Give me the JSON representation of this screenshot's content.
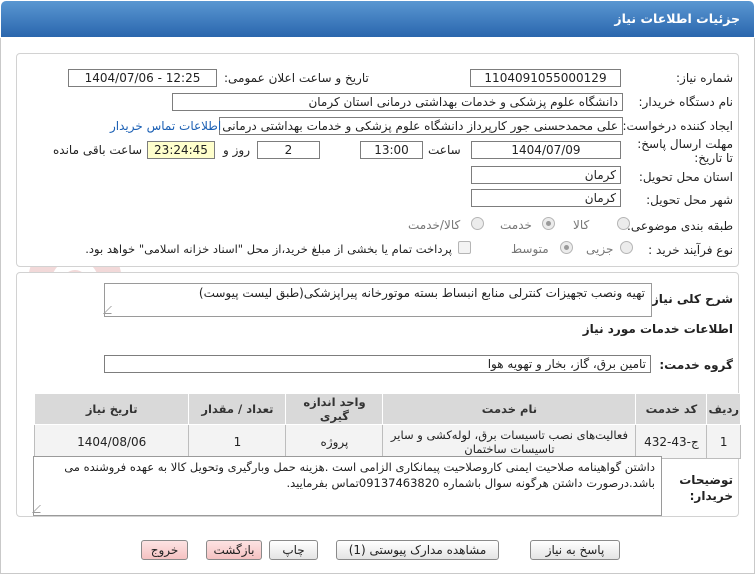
{
  "header": {
    "title": "جزئیات اطلاعات نیاز"
  },
  "form": {
    "need_number_label": "شماره نیاز:",
    "need_number": "1104091055000129",
    "announce_label": "تاریخ و ساعت اعلان عمومی:",
    "announce_value": "1404/07/06 - 12:25",
    "buyer_label": "نام دستگاه خریدار:",
    "buyer_value": "دانشگاه علوم پزشکی و خدمات بهداشتی درمانی استان کرمان",
    "creator_label": "ایجاد کننده درخواست:",
    "creator_value": "علی محمدحسنی جور کارپرداز دانشگاه علوم پزشکی و خدمات بهداشتی درمانی",
    "contact_link": "اطلاعات تماس خریدار",
    "deadline_label": "مهلت ارسال پاسخ: تا تاریخ:",
    "deadline_date": "1404/07/09",
    "time_label": "ساعت",
    "deadline_time": "13:00",
    "days_value": "2",
    "days_label": "روز و",
    "remaining_time": "23:24:45",
    "remaining_label": "ساعت باقی مانده",
    "province_label": "استان محل تحویل:",
    "province_value": "کرمان",
    "city_label": "شهر محل تحویل:",
    "city_value": "کرمان",
    "category_label": "طبقه بندی موضوعی:",
    "category_options": [
      "کالا",
      "خدمت",
      "کالا/خدمت"
    ],
    "category_selected": "خدمت",
    "process_label": "نوع فرآیند خرید :",
    "process_options": [
      "جزیی",
      "متوسط"
    ],
    "process_selected": "متوسط",
    "payment_note": "پرداخت تمام یا بخشی از مبلغ خرید،از محل \"اسناد خزانه اسلامی\" خواهد بود."
  },
  "details": {
    "summary_label": "شرح کلی نیاز:",
    "summary_value": "تهیه ونصب تجهیزات کنترلی منابع انبساط بسته موتورخانه پیراپزشکی(طبق لیست پیوست)",
    "services_heading": "اطلاعات خدمات مورد نیاز",
    "service_group_label": "گروه خدمت:",
    "service_group_value": "تامین برق، گاز، بخار و تهویه هوا",
    "table": {
      "columns": [
        "ردیف",
        "کد خدمت",
        "نام خدمت",
        "واحد اندازه گیری",
        "تعداد / مقدار",
        "تاریخ نیاز"
      ],
      "rows": [
        {
          "row": "1",
          "code": "ج-43-432",
          "name": "فعالیت‌های نصب تاسیسات برق، لوله‌کشی و سایر تاسیسات ساختمان",
          "unit": "پروژه",
          "qty": "1",
          "date": "1404/08/06"
        }
      ]
    },
    "buyer_notes_label": "توضیحات خریدار:",
    "buyer_notes": "داشتن گواهینامه صلاحیت ایمنی کاروصلاحیت پیمانکاری الزامی است .هزینه حمل وبارگیری وتحویل کالا به عهده فروشنده می باشد.درصورت داشتن هرگونه سوال باشماره 09137463820تماس بفرمایید."
  },
  "buttons": {
    "reply": "پاسخ به نیاز",
    "attachments": "مشاهده مدارک پیوستی (1)",
    "print": "چاپ",
    "back": "بازگشت",
    "exit": "خروج"
  },
  "watermark": {
    "text": "AriaTender.net"
  },
  "colors": {
    "header_top": "#5a97d2",
    "header_bottom": "#2a66ad",
    "link": "#1a5fb4",
    "timer_bg": "#ffffcc"
  }
}
